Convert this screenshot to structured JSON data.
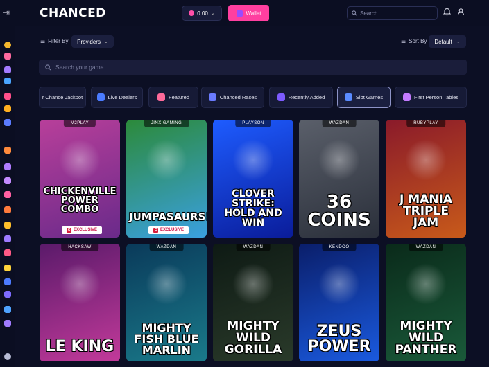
{
  "header": {
    "logo": "CHANCED",
    "balance": "0.00",
    "wallet_label": "Wallet",
    "search_placeholder": "Search"
  },
  "sidebar": {
    "icons": [
      {
        "name": "coin-icon",
        "color": "#f5b82e"
      },
      {
        "name": "home-icon",
        "color": "#ff6aa0"
      },
      {
        "name": "ticket-icon",
        "color": "#a37bff"
      },
      {
        "name": "gift-icon",
        "color": "#4aa5ff"
      },
      {
        "name": "mask-icon",
        "color": "#ff4f8b"
      },
      {
        "name": "ticket-gold-icon",
        "color": "#ffb020"
      },
      {
        "name": "cube-icon",
        "color": "#5a7bff"
      },
      {
        "name": "fire-icon",
        "color": "#ff8a3c"
      },
      {
        "name": "rocket-icon",
        "color": "#b07cff"
      },
      {
        "name": "diamond-icon",
        "color": "#c38bff"
      },
      {
        "name": "lollipop-icon",
        "color": "#ff5fa2"
      },
      {
        "name": "chest-icon",
        "color": "#ff7a3c"
      },
      {
        "name": "trophy-icon",
        "color": "#ffbf2b"
      },
      {
        "name": "mask2-icon",
        "color": "#9e7bff"
      },
      {
        "name": "card-icon",
        "color": "#ff5a86"
      },
      {
        "name": "star-icon",
        "color": "#ffd43b"
      },
      {
        "name": "flag-icon",
        "color": "#4d7bff"
      },
      {
        "name": "refresh-icon",
        "color": "#7d6bff"
      },
      {
        "name": "slots-icon",
        "color": "#4fa3ff"
      },
      {
        "name": "dice-icon",
        "color": "#a07bff"
      },
      {
        "name": "headset-icon",
        "color": "#b8bcd6"
      }
    ]
  },
  "filters": {
    "filter_by_label": "Filter By",
    "providers_label": "Providers",
    "sort_by_label": "Sort By",
    "sort_value": "Default",
    "search_placeholder": "Search your game"
  },
  "categories": [
    {
      "label": "r Chance Jackpot",
      "icon": "jackpot-icon",
      "color": "#ffb020",
      "active": false
    },
    {
      "label": "Live Dealers",
      "icon": "live-dealers-icon",
      "color": "#4a7bff",
      "active": false
    },
    {
      "label": "Featured",
      "icon": "featured-icon",
      "color": "#ff6a9a",
      "active": false
    },
    {
      "label": "Chanced Races",
      "icon": "races-icon",
      "color": "#6a7bff",
      "active": false
    },
    {
      "label": "Recently Added",
      "icon": "recent-icon",
      "color": "#7d5bff",
      "active": false
    },
    {
      "label": "Slot Games",
      "icon": "slot-games-icon",
      "color": "#5a8bff",
      "active": true
    },
    {
      "label": "First Person Tables",
      "icon": "first-person-icon",
      "color": "#c47bff",
      "active": false
    }
  ],
  "games": [
    {
      "provider": "M2PLAY",
      "title": "CHICKENVILLE POWER COMBO",
      "exclusive": "EXCLUSIVE",
      "bg": "#6a2a8a",
      "bg2": "#b83f9a"
    },
    {
      "provider": "JINX GAMING",
      "title": "JUMPASAURS!",
      "exclusive": "EXCLUSIVE",
      "bg": "#3aa0e0",
      "bg2": "#2c8a3a"
    },
    {
      "provider": "PLAYSON",
      "title": "CLOVER STRIKE: HOLD AND WIN",
      "exclusive": "",
      "bg": "#0a1c9a",
      "bg2": "#1e5cff"
    },
    {
      "provider": "WAZDAN",
      "title": "36 COINS",
      "exclusive": "",
      "bg": "#2a2f3a",
      "bg2": "#5a5f6a"
    },
    {
      "provider": "RUBYPLAY",
      "title": "J MANIA TRIPLE JAM",
      "exclusive": "",
      "bg": "#c85a1a",
      "bg2": "#8a1a2a"
    },
    {
      "provider": "HACKSAW",
      "title": "LE KING",
      "exclusive": "",
      "bg": "#c23a9a",
      "bg2": "#5a1a6a"
    },
    {
      "provider": "WAZDAN",
      "title": "MIGHTY FISH BLUE MARLIN",
      "exclusive": "",
      "bg": "#1a7a8a",
      "bg2": "#0a3a5a"
    },
    {
      "provider": "WAZDAN",
      "title": "MIGHTY WILD GORILLA",
      "exclusive": "",
      "bg": "#2a3a2a",
      "bg2": "#0e1a14"
    },
    {
      "provider": "KENDOO",
      "title": "ZEUS POWER",
      "exclusive": "",
      "bg": "#1a5adf",
      "bg2": "#0a1e6a"
    },
    {
      "provider": "WAZDAN",
      "title": "MIGHTY WILD PANTHER",
      "exclusive": "",
      "bg": "#1a5a3a",
      "bg2": "#0a2a1a"
    }
  ]
}
